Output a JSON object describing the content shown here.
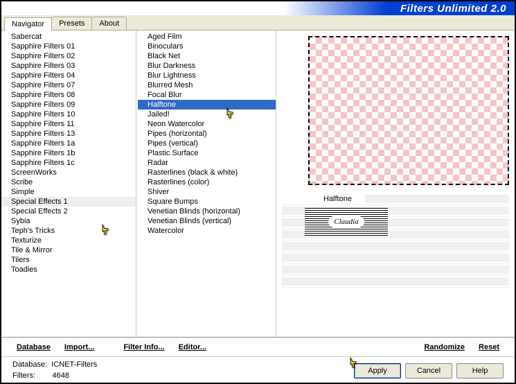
{
  "header": {
    "title": "Filters Unlimited 2.0"
  },
  "tabs": [
    {
      "label": "Navigator"
    },
    {
      "label": "Presets"
    },
    {
      "label": "About"
    }
  ],
  "categories": [
    "Sabercat",
    "Sapphire Filters 01",
    "Sapphire Filters 02",
    "Sapphire Filters 03",
    "Sapphire Filters 04",
    "Sapphire Filters 07",
    "Sapphire Filters 08",
    "Sapphire Filters 09",
    "Sapphire Filters 10",
    "Sapphire Filters 11",
    "Sapphire Filters 13",
    "Sapphire Filters 1a",
    "Sapphire Filters 1b",
    "Sapphire Filters 1c",
    "ScreenWorks",
    "Scribe",
    "Simple",
    "Special Effects 1",
    "Special Effects 2",
    "Sybia",
    "Teph's Tricks",
    "Texturize",
    "Tile & Mirror",
    "Tilers",
    "Toadies"
  ],
  "selectedCategory": "Special Effects 1",
  "filters": [
    "Aged Film",
    "Binoculars",
    "Black Net",
    "Blur Darkness",
    "Blur Lightness",
    "Blurred Mesh",
    "Focal Blur",
    "Halftone",
    "Jailed!",
    "Neon Watercolor",
    "Pipes (horizontal)",
    "Pipes (vertical)",
    "Plastic Surface",
    "Radar",
    "Rasterlines (black & white)",
    "Rasterlines (color)",
    "Shiver",
    "Square Bumps",
    "Venetian Blinds (horizontal)",
    "Venetian Blinds (vertical)",
    "Watercolor"
  ],
  "selectedFilter": "Halftone",
  "paramLabel": "Halftone",
  "toolbar": {
    "database": "Database",
    "import": "Import...",
    "filterinfo": "Filter Info...",
    "editor": "Editor...",
    "randomize": "Randomize",
    "reset": "Reset"
  },
  "footer": {
    "dbLabel": "Database:",
    "dbValue": "ICNET-Filters",
    "filtersLabel": "Filters:",
    "filtersValue": "4648",
    "apply": "Apply",
    "cancel": "Cancel",
    "help": "Help"
  },
  "watermark": "Claudia"
}
